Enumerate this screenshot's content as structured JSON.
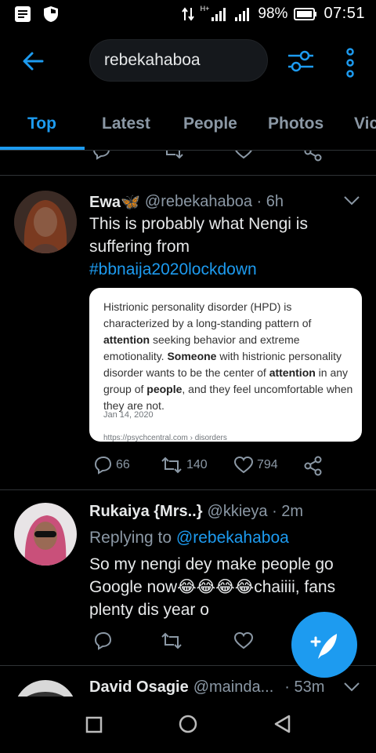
{
  "status_bar": {
    "network": "H+",
    "battery": "98%",
    "time": "07:51"
  },
  "search": {
    "query": "rebekahaboa"
  },
  "tabs": [
    {
      "label": "Top",
      "active": true
    },
    {
      "label": "Latest",
      "active": false
    },
    {
      "label": "People",
      "active": false
    },
    {
      "label": "Photos",
      "active": false
    },
    {
      "label": "Vic",
      "active": false
    }
  ],
  "tweets": [
    {
      "name": "Ewa🦋",
      "handle": "@rebekahaboa · 6h",
      "text_before": "This is probably what Nengi is suffering from ",
      "hashtag": "#bbnaija2020lockdown",
      "media": {
        "p1": "Histrionic personality disorder (HPD) is characterized by a long-standing pattern of ",
        "b1": "attention",
        "p2": " seeking behavior and extreme emotionality. ",
        "b2": "Someone",
        "p3": " with histrionic personality disorder wants to be the center of ",
        "b3": "attention",
        "p4": " in any group of ",
        "b4": "people",
        "p5": ", and they feel uncomfortable when they are not.",
        "date": "Jan 14, 2020",
        "url": "https://psychcentral.com › disorders"
      },
      "replies": "66",
      "retweets": "140",
      "likes": "794"
    },
    {
      "name": "Rukaiya {Mrs..}",
      "handle": "@kkieya · 2m",
      "replying_label": "Replying to ",
      "replying_handle": "@rebekahaboa",
      "text": "So my nengi dey make people go Google now😂😂😂😂chaiiii, fans plenty dis year o"
    },
    {
      "name": "David Osagie",
      "handle": "@mainda...",
      "time": "· 53m"
    }
  ],
  "colors": {
    "accent": "#1d9bf0",
    "background": "#000000",
    "muted": "#8b98a5"
  }
}
